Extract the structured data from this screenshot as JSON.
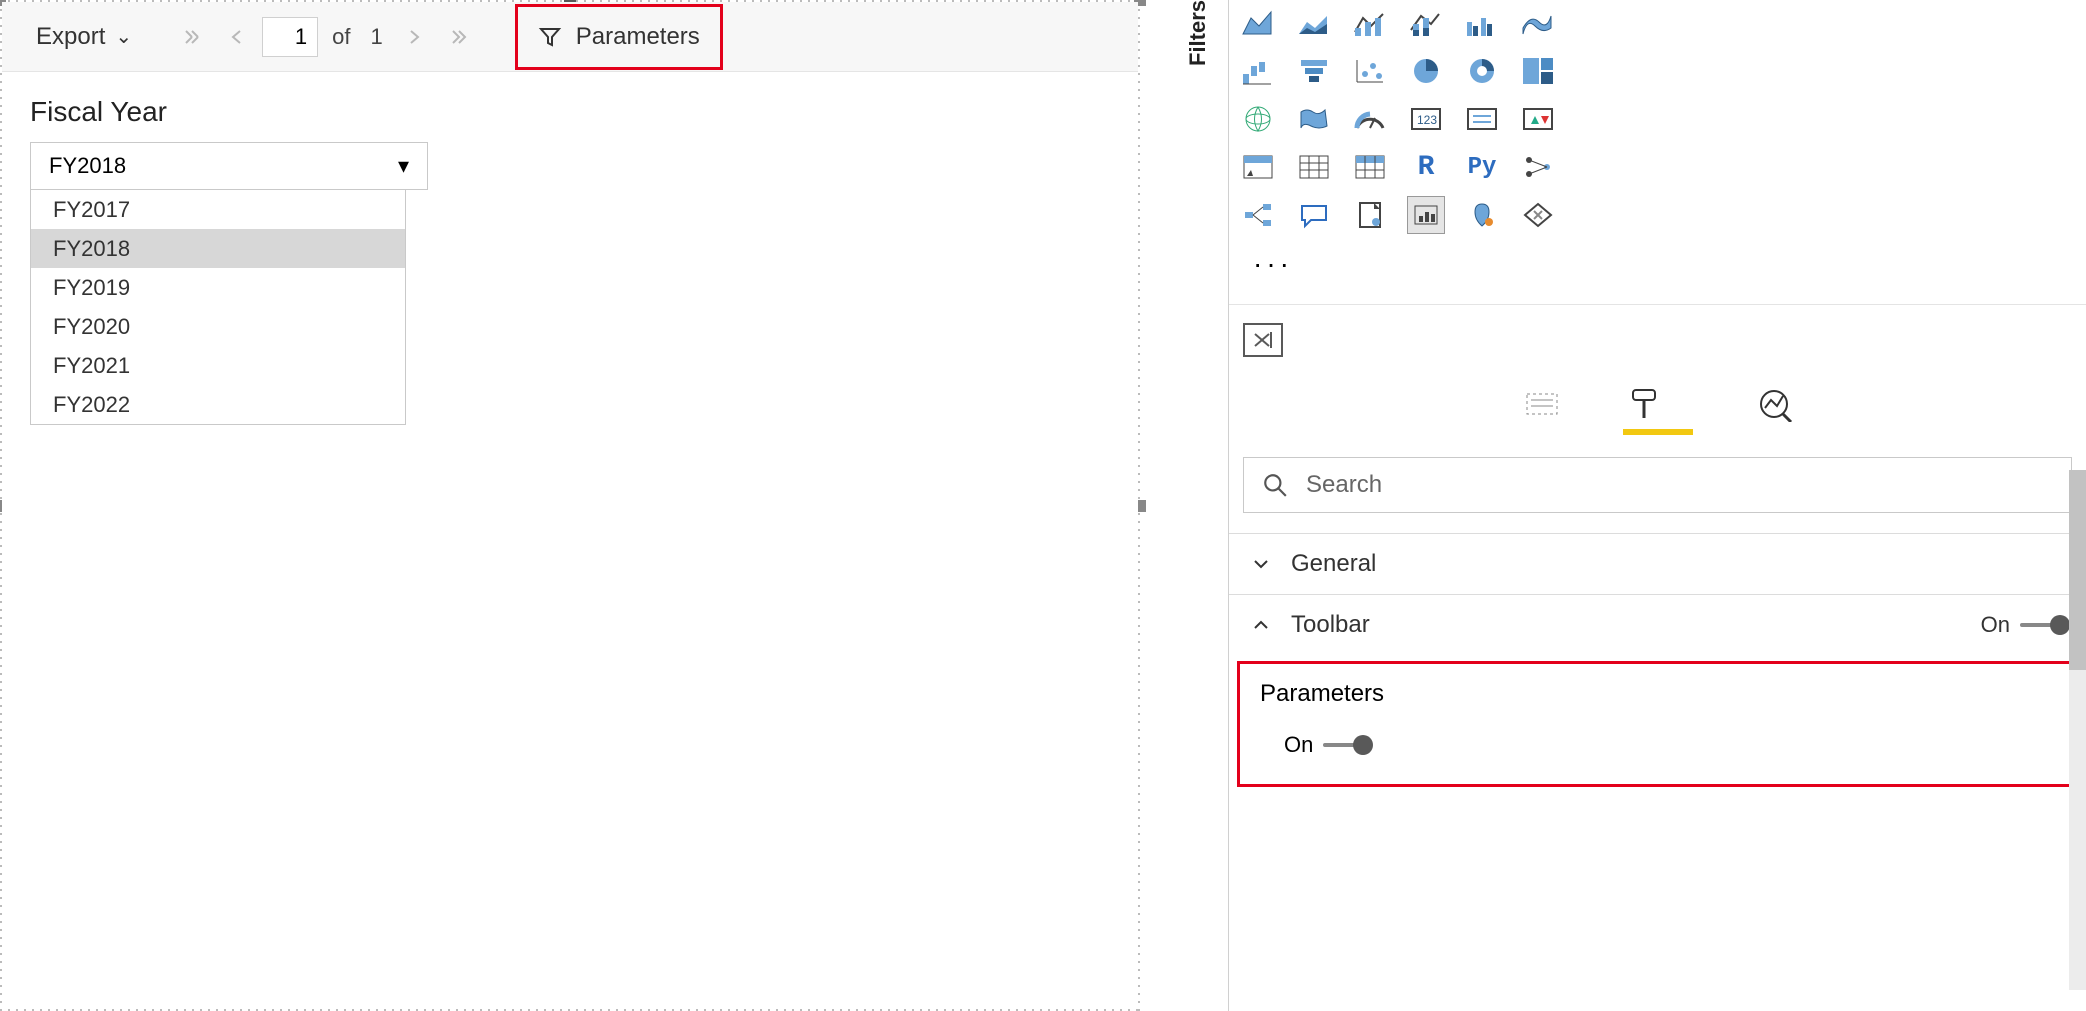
{
  "toolbar": {
    "export_label": "Export",
    "page_current": "1",
    "page_of_label": "of",
    "page_total": "1",
    "parameters_btn": "Parameters"
  },
  "parameter": {
    "label": "Fiscal Year",
    "selected": "FY2018",
    "options": [
      "FY2017",
      "FY2018",
      "FY2019",
      "FY2020",
      "FY2021",
      "FY2022"
    ]
  },
  "filters_tab": "Filters",
  "search": {
    "placeholder": "Search"
  },
  "format_cards": {
    "general": "General",
    "toolbar_group": "Toolbar",
    "toolbar_state": "On",
    "parameters_label": "Parameters",
    "parameters_state": "On"
  },
  "viz_icons": [
    [
      "area-chart",
      "stacked-area",
      "line-chart",
      "line-stacked",
      "line-clustered",
      "ribbon"
    ],
    [
      "waterfall",
      "funnel",
      "scatter",
      "pie",
      "donut",
      "treemap"
    ],
    [
      "map",
      "filled-map",
      "gauge",
      "card",
      "multi-card",
      "kpi"
    ],
    [
      "slicer",
      "table",
      "matrix",
      "r-visual",
      "py-visual",
      "key-influencers"
    ],
    [
      "decomposition",
      "qa",
      "paginated",
      "powerapps",
      "arcgis",
      "custom"
    ]
  ]
}
